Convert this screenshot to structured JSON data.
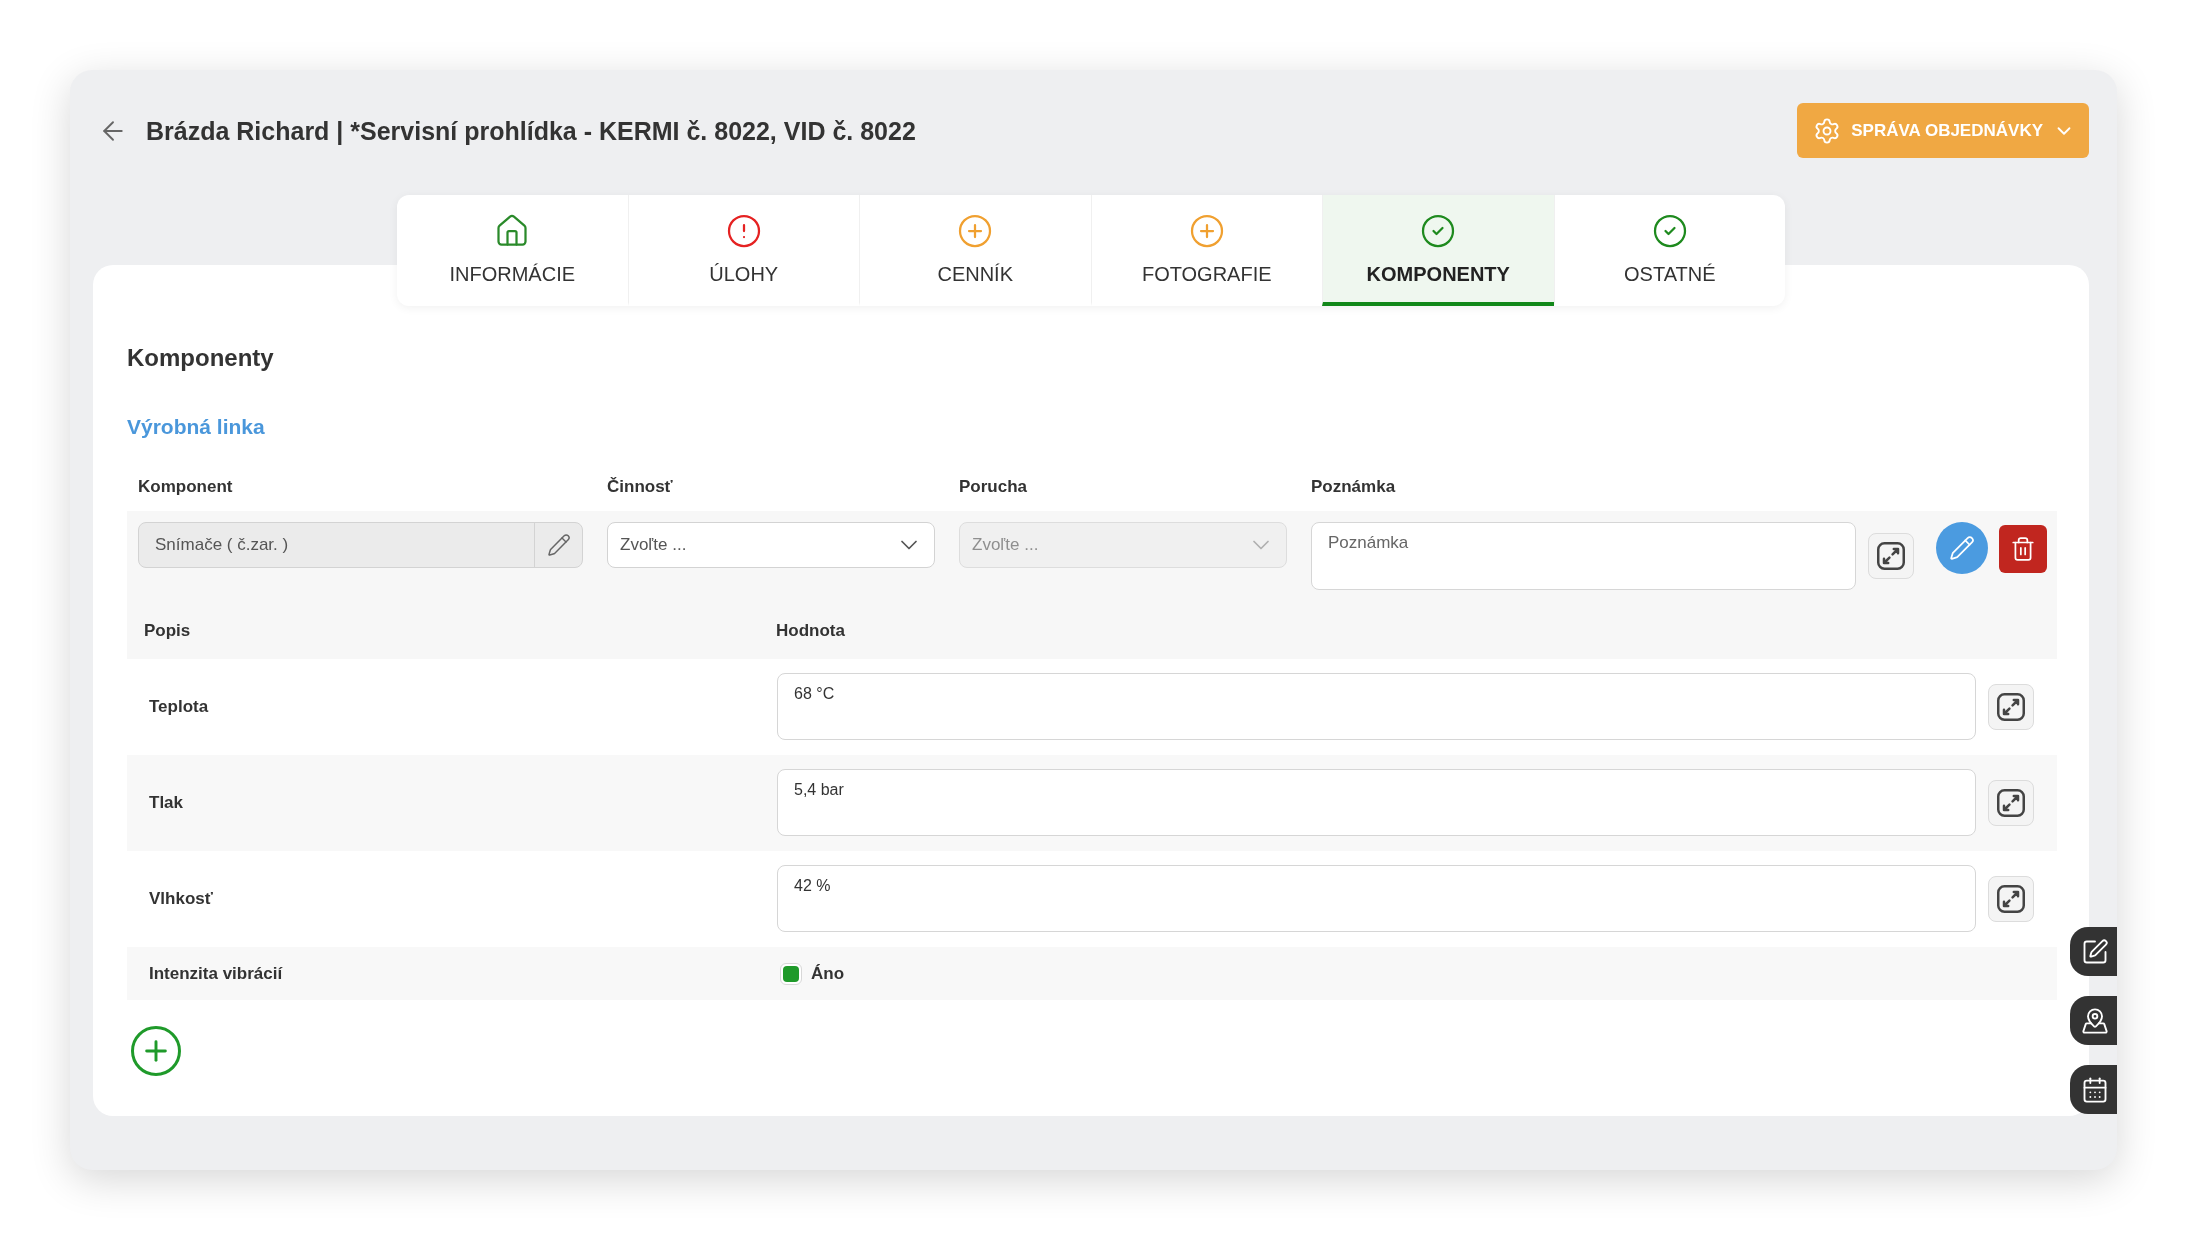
{
  "header": {
    "title": "Brázda Richard | *Servisní prohlídka - KERMI č. 8022, VID č. 8022",
    "action_button": "SPRÁVA OBJEDNÁVKY"
  },
  "tabs": [
    {
      "label": "INFORMÁCIE",
      "kind": "home",
      "selected": false
    },
    {
      "label": "ÚLOHY",
      "kind": "alert",
      "selected": false
    },
    {
      "label": "CENNÍK",
      "kind": "add",
      "selected": false
    },
    {
      "label": "FOTOGRAFIE",
      "kind": "add",
      "selected": false
    },
    {
      "label": "KOMPONENTY",
      "kind": "done",
      "selected": true
    },
    {
      "label": "OSTATNÉ",
      "kind": "done",
      "selected": false
    }
  ],
  "section": {
    "title": "Komponenty",
    "subtitle": "Výrobná linka"
  },
  "component_columns": [
    "Komponent",
    "Činnosť",
    "Porucha",
    "Poznámka"
  ],
  "component": {
    "name": "Snímače ( č.zar. )",
    "activity": {
      "placeholder": "Zvoľte ...",
      "disabled": false
    },
    "fault": {
      "placeholder": "Zvoľte ...",
      "disabled": true
    },
    "note": {
      "placeholder": "Poznámka"
    }
  },
  "parameter_columns": [
    "Popis",
    "Hodnota"
  ],
  "parameters": [
    {
      "kind": "text",
      "label": "Teplota",
      "value": "68 °C"
    },
    {
      "kind": "text",
      "label": "Tlak",
      "value": "5,4 bar"
    },
    {
      "kind": "text",
      "label": "Vlhkosť",
      "value": "42 %"
    },
    {
      "kind": "checkbox",
      "label": "Intenzita vibrácií",
      "checked": true,
      "text": "Áno"
    }
  ]
}
